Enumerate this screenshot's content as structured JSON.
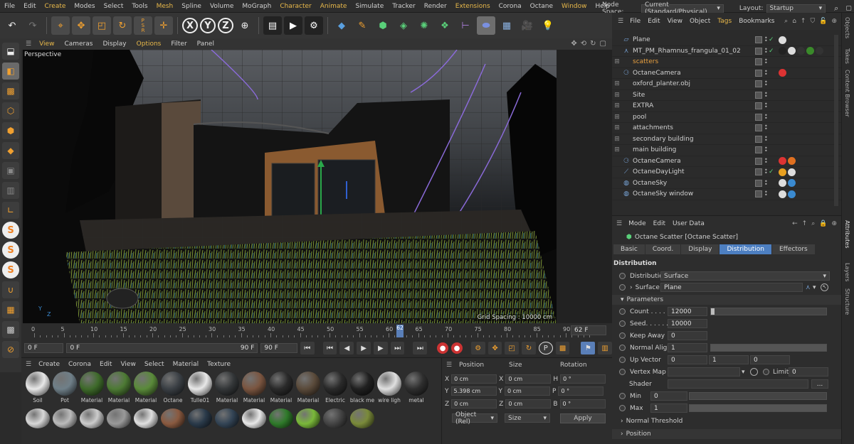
{
  "menubar": {
    "items": [
      {
        "label": "File",
        "hl": false
      },
      {
        "label": "Edit",
        "hl": false
      },
      {
        "label": "Create",
        "hl": true
      },
      {
        "label": "Modes",
        "hl": false
      },
      {
        "label": "Select",
        "hl": false
      },
      {
        "label": "Tools",
        "hl": false
      },
      {
        "label": "Mesh",
        "hl": true
      },
      {
        "label": "Spline",
        "hl": false
      },
      {
        "label": "Volume",
        "hl": false
      },
      {
        "label": "MoGraph",
        "hl": false
      },
      {
        "label": "Character",
        "hl": true
      },
      {
        "label": "Animate",
        "hl": true
      },
      {
        "label": "Simulate",
        "hl": false
      },
      {
        "label": "Tracker",
        "hl": false
      },
      {
        "label": "Render",
        "hl": false
      },
      {
        "label": "Extensions",
        "hl": true
      },
      {
        "label": "Corona",
        "hl": false
      },
      {
        "label": "Octane",
        "hl": false
      },
      {
        "label": "Window",
        "hl": true
      },
      {
        "label": "Help",
        "hl": false
      }
    ],
    "node_space_label": "Node Space:",
    "node_space_value": "Current (Standard/Physical)",
    "layout_label": "Layout:",
    "layout_value": "Startup"
  },
  "viewport": {
    "menu": [
      {
        "label": "View",
        "hl": true
      },
      {
        "label": "Cameras",
        "hl": false
      },
      {
        "label": "Display",
        "hl": false
      },
      {
        "label": "Options",
        "hl": true
      },
      {
        "label": "Filter",
        "hl": false
      },
      {
        "label": "Panel",
        "hl": false
      }
    ],
    "name": "Perspective",
    "grid_spacing": "Grid Spacing : 10000 cm",
    "axis_y": "Y",
    "axis_z": "Z"
  },
  "timeline": {
    "ticks": [
      "0",
      "5",
      "10",
      "15",
      "20",
      "25",
      "30",
      "35",
      "40",
      "45",
      "50",
      "55",
      "60",
      "65",
      "70",
      "75",
      "80",
      "85",
      "90"
    ],
    "current_marker": "62",
    "current_frame": "62 F",
    "start_frame": "0 F",
    "min_frame": "0 F",
    "max_frame": "90 F",
    "end_frame": "90 F"
  },
  "materials": {
    "menu": [
      "Create",
      "Corona",
      "Edit",
      "View",
      "Select",
      "Material",
      "Texture"
    ],
    "row1": [
      {
        "label": "Soil",
        "color": "#e8e8e8"
      },
      {
        "label": "Pot",
        "color": "#6f7f88"
      },
      {
        "label": "Material",
        "color": "#3e6a2a"
      },
      {
        "label": "Material",
        "color": "#4d7a34"
      },
      {
        "label": "Material",
        "color": "#5a8a3a"
      },
      {
        "label": "Octane",
        "color": "#3a3f44"
      },
      {
        "label": "Tulle01",
        "color": "#e8e8e8"
      },
      {
        "label": "Material",
        "color": "#333638"
      },
      {
        "label": "Material",
        "color": "#7a5540"
      },
      {
        "label": "Material",
        "color": "#2a2a2a"
      },
      {
        "label": "Material",
        "color": "#5a4a3a"
      },
      {
        "label": "Electric",
        "color": "#2a2a2a"
      },
      {
        "label": "black me",
        "color": "#202020"
      },
      {
        "label": "wire ligh",
        "color": "#e0e0e0"
      },
      {
        "label": "metal",
        "color": "#2e2e2e"
      }
    ],
    "row2_colors": [
      "#d8d8d8",
      "#bbbbbb",
      "#cccccc",
      "#999999",
      "#e0e0e0",
      "#8a5a40",
      "#2a3a4a",
      "#334455",
      "#e8e8e8",
      "#2f7a2a",
      "#7ab83a",
      "#444444",
      "#7a8a3a"
    ]
  },
  "coords": {
    "headers": [
      "Position",
      "Size",
      "Rotation"
    ],
    "rows": [
      {
        "axis": "X",
        "pos": "0 cm",
        "size_axis": "X",
        "size": "0 cm",
        "rot_axis": "H",
        "rot": "0 °"
      },
      {
        "axis": "Y",
        "pos": "5.398 cm",
        "size_axis": "Y",
        "size": "0 cm",
        "rot_axis": "P",
        "rot": "0 °"
      },
      {
        "axis": "Z",
        "pos": "0 cm",
        "size_axis": "Z",
        "size": "0 cm",
        "rot_axis": "B",
        "rot": "0 °"
      }
    ],
    "mode": "Object (Rel)",
    "size_mode": "Size",
    "apply": "Apply"
  },
  "objects": {
    "menu": [
      {
        "label": "File",
        "hl": false
      },
      {
        "label": "Edit",
        "hl": false
      },
      {
        "label": "View",
        "hl": false
      },
      {
        "label": "Object",
        "hl": false
      },
      {
        "label": "Tags",
        "hl": true
      },
      {
        "label": "Bookmarks",
        "hl": false
      }
    ],
    "items": [
      {
        "name": "Plane",
        "icon": "▱",
        "orange": false,
        "check": true,
        "tags": [
          "#ddd"
        ]
      },
      {
        "name": "MT_PM_Rhamnus_frangula_01_02",
        "icon": "⋏",
        "orange": false,
        "check": true,
        "tags": [
          "#222",
          "#ddd",
          "#333",
          "#3a8a2a",
          "#333"
        ]
      },
      {
        "name": "scatters",
        "icon": "",
        "orange": true,
        "check": false,
        "tags": []
      },
      {
        "name": "OctaneCamera",
        "icon": "⚆",
        "orange": false,
        "check": false,
        "tags": [
          "#d33"
        ]
      },
      {
        "name": "oxford_planter.obj",
        "icon": "",
        "orange": false,
        "check": false,
        "tags": []
      },
      {
        "name": "Site",
        "icon": "",
        "orange": false,
        "check": false,
        "tags": []
      },
      {
        "name": "EXTRA",
        "icon": "",
        "orange": false,
        "check": false,
        "tags": []
      },
      {
        "name": "pool",
        "icon": "",
        "orange": false,
        "check": false,
        "tags": []
      },
      {
        "name": "attachments",
        "icon": "",
        "orange": false,
        "check": false,
        "tags": []
      },
      {
        "name": "secondary building",
        "icon": "",
        "orange": false,
        "check": false,
        "tags": []
      },
      {
        "name": "main building",
        "icon": "",
        "orange": false,
        "check": false,
        "tags": []
      },
      {
        "name": "OctaneCamera",
        "icon": "⚆",
        "orange": false,
        "check": false,
        "tags": [
          "#d33",
          "#e07020"
        ]
      },
      {
        "name": "OctaneDayLight",
        "icon": "⟋",
        "orange": false,
        "check": true,
        "tags": [
          "#e8a020",
          "#ddd"
        ]
      },
      {
        "name": "OctaneSky",
        "icon": "◍",
        "orange": false,
        "check": false,
        "tags": [
          "#ddd",
          "#3a8ad0"
        ]
      },
      {
        "name": "OctaneSky window",
        "icon": "◍",
        "orange": false,
        "check": false,
        "tags": [
          "#ddd",
          "#3a8ad0"
        ]
      }
    ]
  },
  "attributes": {
    "menu": [
      "Mode",
      "Edit",
      "User Data"
    ],
    "title": "Octane Scatter [Octane Scatter]",
    "tabs": [
      {
        "label": "Basic",
        "active": false
      },
      {
        "label": "Coord.",
        "active": false
      },
      {
        "label": "Display",
        "active": false
      },
      {
        "label": "Distribution",
        "active": true
      },
      {
        "label": "Effectors",
        "active": false
      }
    ],
    "section": "Distribution",
    "distribution_label": "Distribution",
    "distribution_value": "Surface",
    "surface_label": "Surface",
    "surface_value": "Plane",
    "parameters_label": "Parameters",
    "count_label": "Count . . . . . .",
    "count_value": "12000",
    "count_fraction": 0.03,
    "seed_label": "Seed. . . . . . .",
    "seed_value": "10000",
    "keepaway_label": "Keep Away",
    "keepaway_value": "0",
    "normalalign_label": "Normal Align",
    "normalalign_value": "1",
    "normalalign_fraction": 1.0,
    "upvector_label": "Up Vector",
    "upvector_x": "0",
    "upvector_y": "1",
    "upvector_z": "0",
    "vertexmap_label": "Vertex Map",
    "limit_label": "Limit",
    "limit_value": "0",
    "shader_label": "Shader",
    "shader_btn": "...",
    "min_label": "Min",
    "min_value": "0",
    "min_fraction": 0.0,
    "max_label": "Max",
    "max_value": "1",
    "max_fraction": 1.0,
    "normal_threshold_label": "Normal Threshold",
    "position_label": "Position"
  },
  "right_tabs": [
    "Objects",
    "Takes",
    "Content Browser",
    "Attributes",
    "Layers",
    "Structure"
  ]
}
